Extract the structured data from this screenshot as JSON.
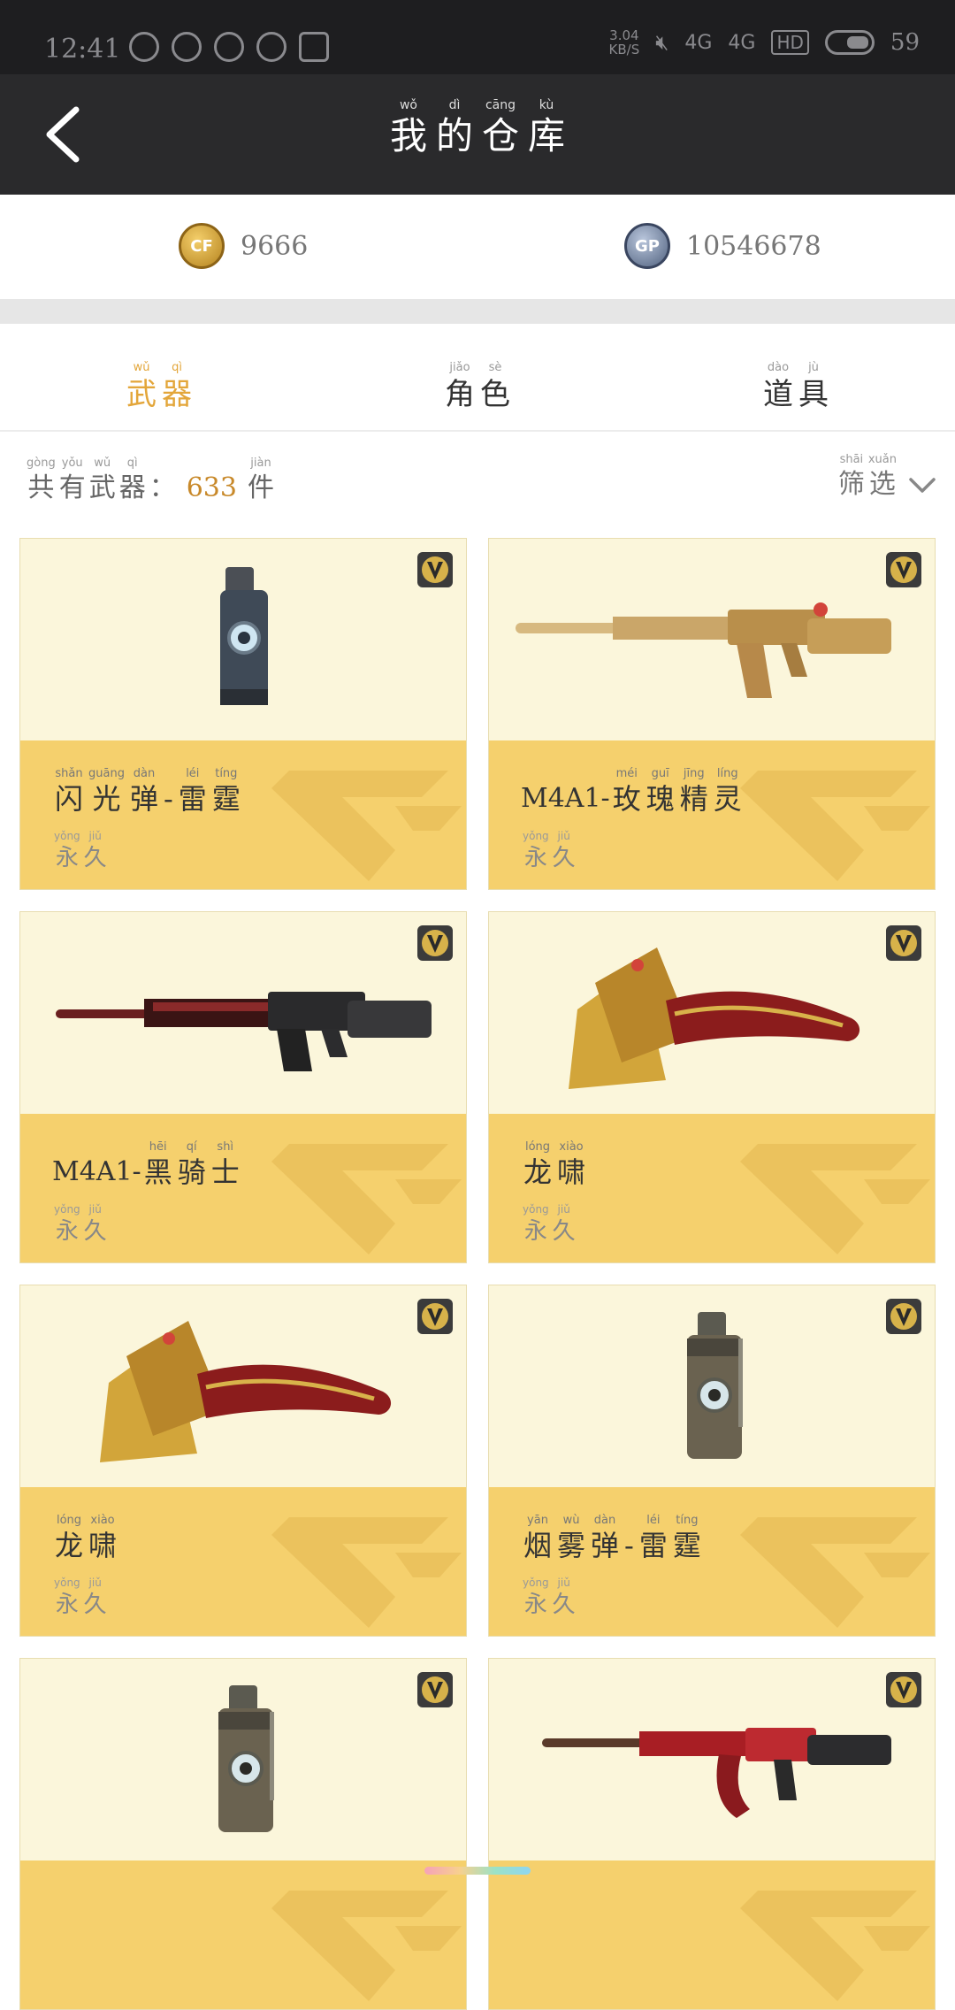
{
  "status_bar": {
    "time": "12:41",
    "speed_value": "3.04",
    "speed_unit": "KB/S",
    "signal_1": "4G",
    "signal_2": "4G",
    "hd": "HD",
    "battery": "59"
  },
  "header": {
    "title": [
      {
        "py": "wǒ",
        "hz": "我"
      },
      {
        "py": "dì",
        "hz": "的"
      },
      {
        "py": "cāng",
        "hz": "仓"
      },
      {
        "py": "kù",
        "hz": "库"
      }
    ]
  },
  "currency": {
    "cf_icon_label": "CF",
    "cf_amount": "9666",
    "gp_icon_label": "GP",
    "gp_amount": "10546678"
  },
  "tabs": [
    {
      "chars": [
        {
          "py": "wǔ",
          "hz": "武"
        },
        {
          "py": "qì",
          "hz": "器"
        }
      ],
      "active": true
    },
    {
      "chars": [
        {
          "py": "jiǎo",
          "hz": "角"
        },
        {
          "py": "sè",
          "hz": "色"
        }
      ],
      "active": false
    },
    {
      "chars": [
        {
          "py": "dào",
          "hz": "道"
        },
        {
          "py": "jù",
          "hz": "具"
        }
      ],
      "active": false
    }
  ],
  "count": {
    "prefix": [
      {
        "py": "gòng",
        "hz": "共"
      },
      {
        "py": "yǒu",
        "hz": "有"
      },
      {
        "py": "wǔ",
        "hz": "武"
      },
      {
        "py": "qì",
        "hz": "器"
      },
      {
        "py": "",
        "hz": "："
      }
    ],
    "number": "633",
    "suffix": [
      {
        "py": "jiàn",
        "hz": "件"
      }
    ]
  },
  "filter": {
    "chars": [
      {
        "py": "shāi",
        "hz": "筛"
      },
      {
        "py": "xuǎn",
        "hz": "选"
      }
    ]
  },
  "duration": [
    {
      "py": "yǒng",
      "hz": "永"
    },
    {
      "py": "jiǔ",
      "hz": "久"
    }
  ],
  "items": [
    {
      "latin": "",
      "name": [
        {
          "py": "shǎn",
          "hz": "闪"
        },
        {
          "py": "guāng",
          "hz": "光"
        },
        {
          "py": "dàn",
          "hz": "弹"
        },
        {
          "py": "",
          "hz": "-"
        },
        {
          "py": "léi",
          "hz": "雷"
        },
        {
          "py": "tíng",
          "hz": "霆"
        }
      ],
      "icon": "flash-grenade-icon"
    },
    {
      "latin": "M4A1-",
      "name": [
        {
          "py": "méi",
          "hz": "玫"
        },
        {
          "py": "guī",
          "hz": "瑰"
        },
        {
          "py": "jīng",
          "hz": "精"
        },
        {
          "py": "líng",
          "hz": "灵"
        }
      ],
      "icon": "golden-rifle-icon"
    },
    {
      "latin": "M4A1-",
      "name": [
        {
          "py": "hēi",
          "hz": "黑"
        },
        {
          "py": "qí",
          "hz": "骑"
        },
        {
          "py": "shì",
          "hz": "士"
        }
      ],
      "icon": "black-knight-rifle-icon"
    },
    {
      "latin": "",
      "name": [
        {
          "py": "lóng",
          "hz": "龙"
        },
        {
          "py": "xiào",
          "hz": "啸"
        }
      ],
      "icon": "dragon-axe-icon"
    },
    {
      "latin": "",
      "name": [
        {
          "py": "lóng",
          "hz": "龙"
        },
        {
          "py": "xiào",
          "hz": "啸"
        }
      ],
      "icon": "dragon-axe-icon"
    },
    {
      "latin": "",
      "name": [
        {
          "py": "yān",
          "hz": "烟"
        },
        {
          "py": "wù",
          "hz": "雾"
        },
        {
          "py": "dàn",
          "hz": "弹"
        },
        {
          "py": "",
          "hz": "-"
        },
        {
          "py": "léi",
          "hz": "雷"
        },
        {
          "py": "tíng",
          "hz": "霆"
        }
      ],
      "icon": "smoke-grenade-icon"
    },
    {
      "latin": "",
      "name": [],
      "icon": "smoke-grenade-icon"
    },
    {
      "latin": "",
      "name": [],
      "icon": "red-ak-rifle-icon"
    }
  ],
  "colors": {
    "accent": "#e3a63a",
    "card_bg": "#fdf6d7",
    "card_info": "#f5d06d",
    "header_bg": "#2a2a2c"
  }
}
